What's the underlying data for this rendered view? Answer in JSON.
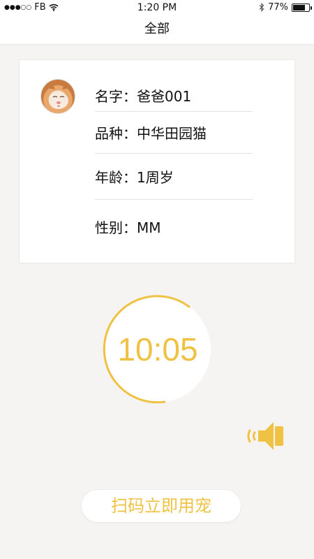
{
  "status_bar": {
    "carrier": "FB",
    "time": "1:20 PM",
    "battery_percent": "77%",
    "battery_level": 0.77
  },
  "nav": {
    "title": "全部"
  },
  "pet": {
    "name": "名字：爸爸001",
    "breed": "品种：中华田园猫",
    "age": "年龄：1周岁",
    "gender": "性别：MM"
  },
  "timer": {
    "display": "10:05",
    "color": "#f0c243"
  },
  "actions": {
    "scan_button": "扫码立即用宠"
  },
  "icons": {
    "signal": "signal-dots-icon",
    "wifi": "wifi-icon",
    "bluetooth": "bluetooth-icon",
    "battery": "battery-icon",
    "speaker": "speaker-icon"
  },
  "colors": {
    "accent": "#f0c243",
    "background": "#f5f4f2"
  }
}
